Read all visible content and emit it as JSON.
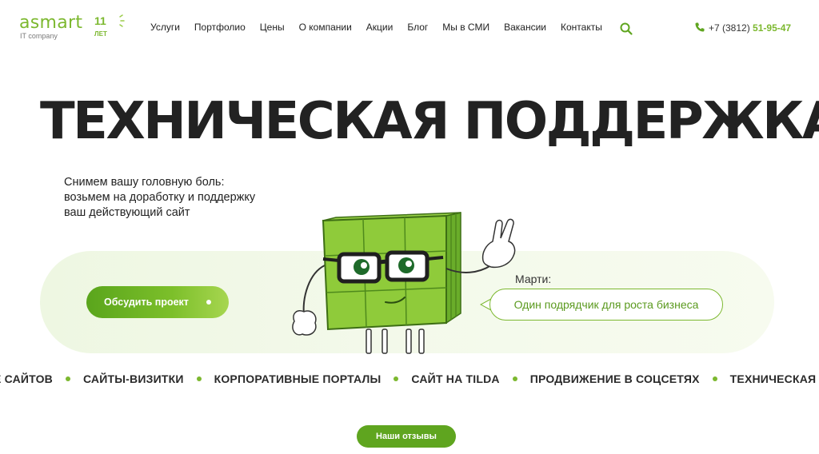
{
  "logo": {
    "name": "asmart",
    "subtitle": "IT company",
    "years_number": "11",
    "years_label": "ЛЕТ"
  },
  "nav": {
    "items": [
      "Услуги",
      "Портфолио",
      "Цены",
      "О компании",
      "Акции",
      "Блог",
      "Мы в СМИ",
      "Вакансии",
      "Контакты"
    ]
  },
  "phone": {
    "prefix": "+7 (3812)",
    "number": "51-95-47"
  },
  "hero": {
    "title": "ТЕХНИЧЕСКАЯ ПОДДЕРЖКА",
    "description_lines": [
      "Снимем вашу головную боль:",
      "возьмем на доработку и поддержку",
      "ваш действующий сайт"
    ],
    "cta_label": "Обсудить проект",
    "speaker": "Марти:",
    "bubble_text": "Один подрядчик для роста бизнеса"
  },
  "ticker": {
    "items": [
      "Е САЙТОВ",
      "САЙТЫ-ВИЗИТКИ",
      "КОРПОРАТИВНЫЕ ПОРТАЛЫ",
      "САЙТ НА TILDA",
      "ПРОДВИЖЕНИЕ В СОЦСЕТЯХ",
      "ТЕХНИЧЕСКАЯ"
    ]
  },
  "reviews_button": "Наши отзывы",
  "colors": {
    "brand_green": "#7cb82f",
    "dark_green": "#5fa51f",
    "text": "#222222",
    "banner_bg": "#eef7e2"
  },
  "icons": [
    "phone-icon",
    "search-icon",
    "mascot-cube"
  ]
}
